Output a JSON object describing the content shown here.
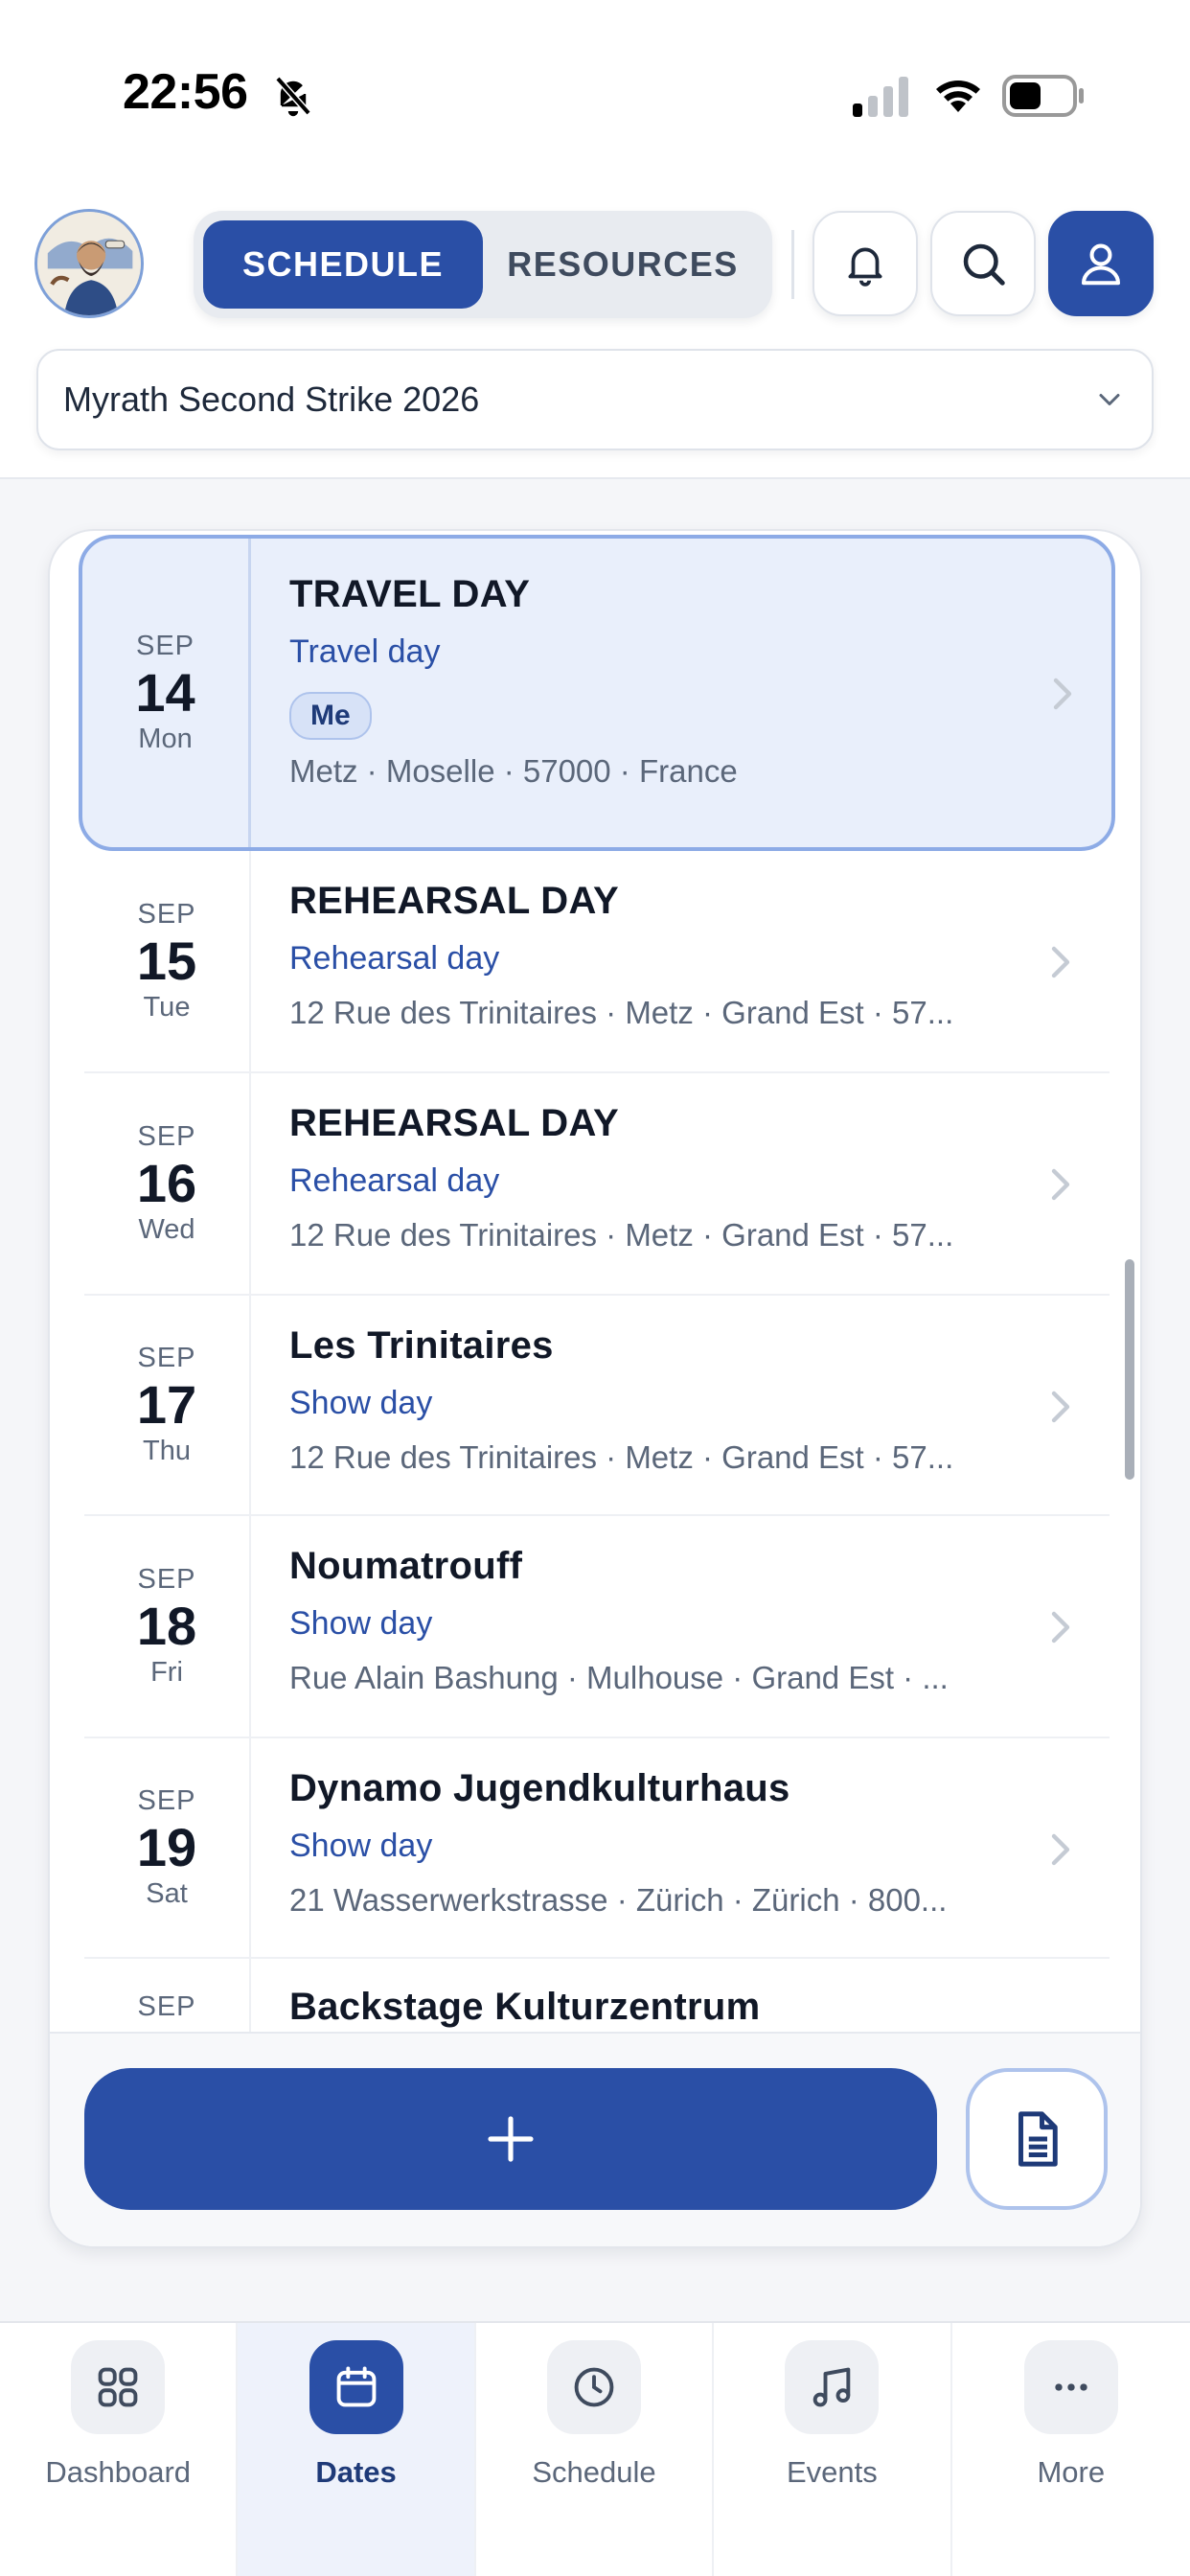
{
  "status_bar": {
    "time": "22:56"
  },
  "header": {
    "segment": {
      "active": "SCHEDULE",
      "inactive": "RESOURCES"
    },
    "tour_selector": {
      "value": "Myrath Second Strike 2026"
    }
  },
  "dates": [
    {
      "month": "SEP",
      "day": "14",
      "weekday": "Mon",
      "title": "TRAVEL DAY",
      "type": "Travel day",
      "chip": "Me",
      "address": "Metz · Moselle · 57000 · France"
    },
    {
      "month": "SEP",
      "day": "15",
      "weekday": "Tue",
      "title": "REHEARSAL DAY",
      "type": "Rehearsal day",
      "address": "12 Rue des Trinitaires · Metz · Grand Est · 57..."
    },
    {
      "month": "SEP",
      "day": "16",
      "weekday": "Wed",
      "title": "REHEARSAL DAY",
      "type": "Rehearsal day",
      "address": "12 Rue des Trinitaires · Metz · Grand Est · 57..."
    },
    {
      "month": "SEP",
      "day": "17",
      "weekday": "Thu",
      "title": "Les Trinitaires",
      "type": "Show day",
      "address": "12 Rue des Trinitaires · Metz · Grand Est · 57..."
    },
    {
      "month": "SEP",
      "day": "18",
      "weekday": "Fri",
      "title": "Noumatrouff",
      "type": "Show day",
      "address": "Rue Alain Bashung · Mulhouse · Grand Est · ..."
    },
    {
      "month": "SEP",
      "day": "19",
      "weekday": "Sat",
      "title": "Dynamo Jugendkulturhaus",
      "type": "Show day",
      "address": "21 Wasserwerkstrasse · Zürich · Zürich · 800..."
    },
    {
      "month": "SEP",
      "title": "Backstage Kulturzentrum"
    }
  ],
  "bottom_nav": [
    {
      "label": "Dashboard",
      "icon": "grid-icon"
    },
    {
      "label": "Dates",
      "icon": "calendar-icon",
      "active": true
    },
    {
      "label": "Schedule",
      "icon": "clock-icon"
    },
    {
      "label": "Events",
      "icon": "music-note-icon"
    },
    {
      "label": "More",
      "icon": "ellipsis-icon"
    }
  ],
  "colors": {
    "primary": "#2a4fa6",
    "selected_bg": "#e9effb",
    "selected_border": "#8dabe6",
    "accent_text": "#2a4fa6"
  }
}
